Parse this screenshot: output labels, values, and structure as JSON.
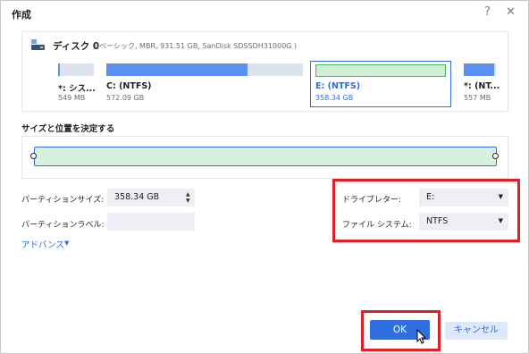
{
  "window": {
    "title": "作成",
    "help_glyph": "?",
    "close_glyph": "✕"
  },
  "disk": {
    "name": "ディスク 0",
    "info": "(ベーシック, MBR, 931.51 GB, SanDisk SDSSDH31000G )",
    "partitions": [
      {
        "name": "*: シス...",
        "size": "549 MB",
        "fill_fraction": 0.05
      },
      {
        "name": "C: (NTFS)",
        "size": "572.09 GB",
        "fill_fraction": 0.72
      },
      {
        "name": "E: (NTFS)",
        "size": "358.34 GB",
        "fill_fraction": 1.0,
        "selected": true
      },
      {
        "name": "*: (NT...",
        "size": "557 MB",
        "fill_fraction": 0.95
      }
    ]
  },
  "size_position": {
    "title": "サイズと位置を決定する"
  },
  "form": {
    "partition_size_label": "パーティションサイズ:",
    "partition_size_value": "358.34 GB",
    "partition_label_label": "パーティションラベル:",
    "partition_label_value": "",
    "advanced_label": "アドバンス",
    "drive_letter_label": "ドライブレター:",
    "drive_letter_value": "E:",
    "file_system_label": "ファイル システム:",
    "file_system_value": "NTFS"
  },
  "buttons": {
    "ok": "OK",
    "cancel": "キャンセル"
  },
  "colors": {
    "accent": "#2e6cd8",
    "highlight": "#e01f26",
    "partition_fill": "#5b8ff0",
    "selected_fill": "#cfeed6"
  }
}
